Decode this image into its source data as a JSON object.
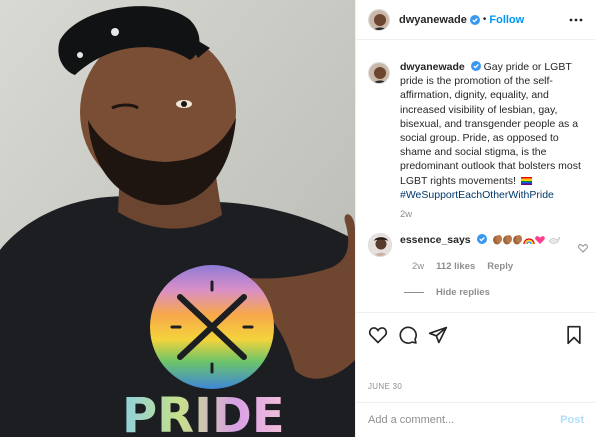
{
  "colors": {
    "text": "#262626",
    "muted": "#8e8e8e",
    "link_blue": "#0095f6",
    "hashtag": "#00376b",
    "post_disabled": "#b2dffc",
    "divider": "#efefef"
  },
  "photo": {
    "shirt_text": "PRIDE"
  },
  "header": {
    "username": "dwyanewade",
    "verified_icon": "verified-badge-icon",
    "separator": "•",
    "follow_label": "Follow",
    "more_icon": "more-options-icon"
  },
  "caption": {
    "username": "dwyanewade",
    "text": "Gay pride or LGBT pride is the promotion of the self-affirmation, dignity, equality, and increased visibility of lesbian, gay, bisexual, and transgender people as a social group. Pride, as opposed to shame and social stigma, is the predominant outlook that bolsters most LGBT rights movements!",
    "flag_icon": "rainbow-flag-icon",
    "hashtag": "#WeSupportEachOtherWithPride",
    "time": "2w"
  },
  "comment": {
    "username": "essence_says",
    "emoji_icons": [
      "clapping-hands-icon",
      "clapping-hands-icon",
      "clapping-hands-icon",
      "rainbow-icon",
      "heart-icon",
      "dove-icon"
    ],
    "time": "2w",
    "likes": "112 likes",
    "reply_label": "Reply",
    "like_icon": "heart-outline-icon"
  },
  "replies": {
    "toggle_label": "Hide replies"
  },
  "actions": {
    "like_icon": "heart-outline-icon",
    "comment_icon": "comment-icon",
    "share_icon": "share-icon",
    "save_icon": "bookmark-icon"
  },
  "date": "JUNE 30",
  "comment_box": {
    "placeholder": "Add a comment...",
    "post_label": "Post"
  }
}
